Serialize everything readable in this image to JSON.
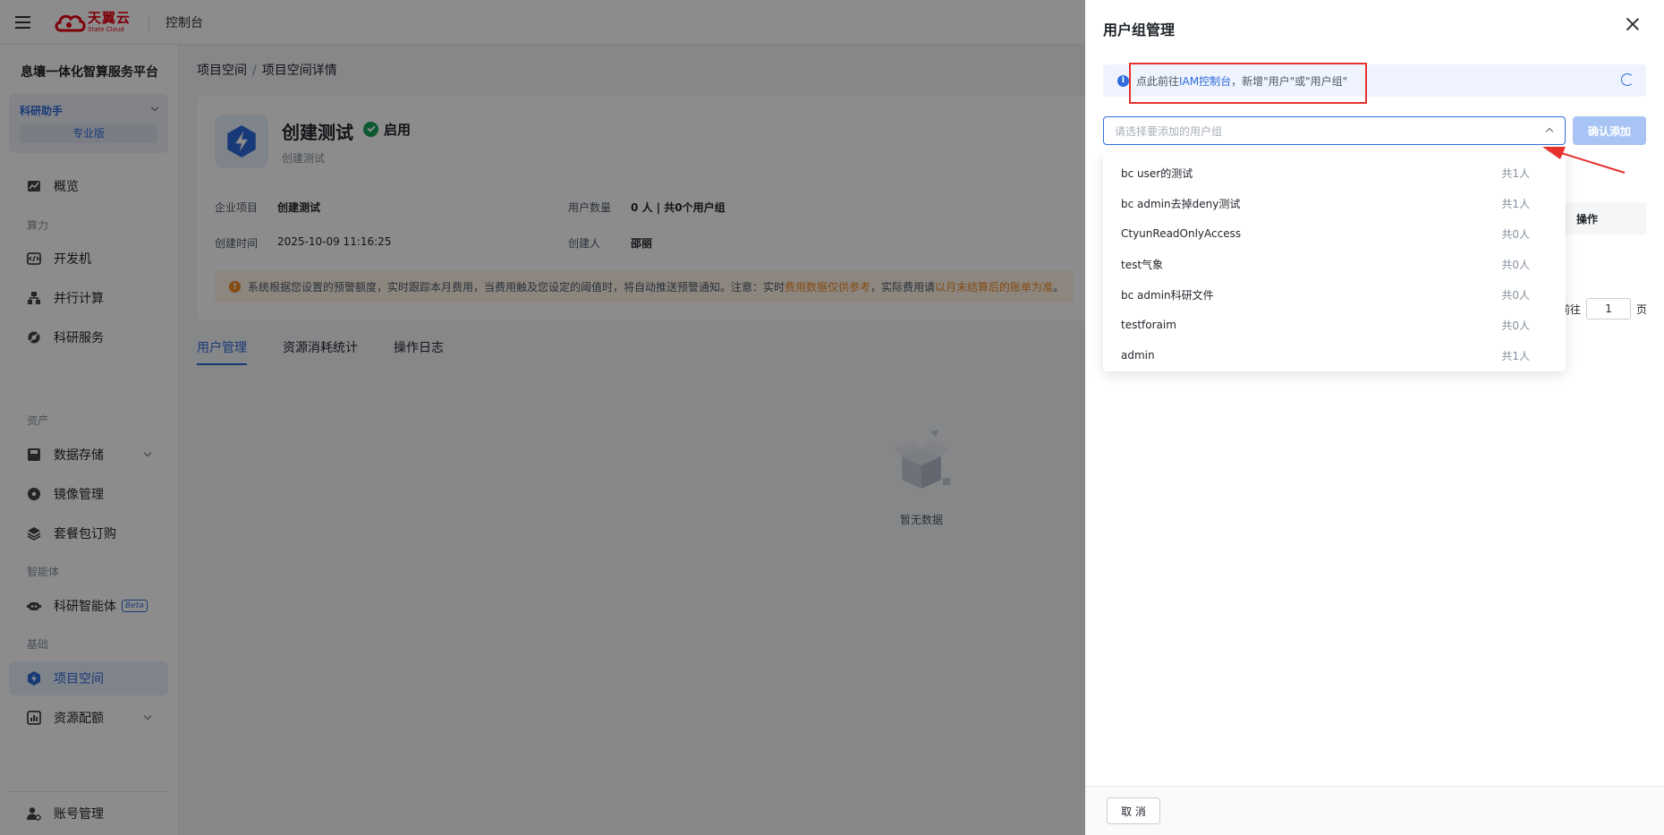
{
  "topbar": {
    "logo_cn": "天翼云",
    "logo_en": "State Cloud",
    "console": "控制台"
  },
  "sidebar": {
    "platform": "息壤一体化智算服务平台",
    "assistant": "科研助手",
    "edition": "专业版",
    "sections": {
      "compute": "算力",
      "assets": "资产",
      "agent": "智能体",
      "basic": "基础"
    },
    "items": [
      {
        "label": "概览",
        "icon": "chart-icon"
      },
      {
        "label": "开发机",
        "icon": "code-icon"
      },
      {
        "label": "并行计算",
        "icon": "cluster-icon"
      },
      {
        "label": "科研服务",
        "icon": "service-icon"
      },
      {
        "label": "数据存储",
        "icon": "storage-icon"
      },
      {
        "label": "镜像管理",
        "icon": "disc-icon"
      },
      {
        "label": "套餐包订购",
        "icon": "layers-icon"
      },
      {
        "label": "科研智能体",
        "icon": "robot-icon"
      },
      {
        "label": "项目空间",
        "icon": "bolt-icon"
      },
      {
        "label": "资源配额",
        "icon": "quota-icon"
      },
      {
        "label": "账号管理",
        "icon": "user-gear-icon"
      }
    ],
    "beta": "Beta"
  },
  "breadcrumb": {
    "root": "项目空间",
    "sep": "/",
    "current": "项目空间详情"
  },
  "project": {
    "name": "创建测试",
    "status": "启用",
    "desc": "创建测试",
    "labels": {
      "enterprise": "企业项目",
      "created": "创建时间",
      "users": "用户数量",
      "creator": "创建人"
    },
    "values": {
      "enterprise": "创建测试",
      "created": "2025-10-09 11:16:25",
      "users": "0 人 | 共0个用户组",
      "creator": "邵丽"
    },
    "warning": {
      "part1": "系统根据您设置的预警额度，实时跟踪本月费用，当费用触及您设定的阈值时，将自动推送预警通知。注意：实时",
      "hl1": "费用数据仅供参考",
      "part2": "，实际费用请",
      "hl2": "以月末结算后的账单为准",
      "end": "。"
    }
  },
  "tabs": [
    "用户管理",
    "资源消耗统计",
    "操作日志"
  ],
  "empty": "暂无数据",
  "drawer": {
    "title": "用户组管理",
    "tip_prefix": "点此前往 ",
    "tip_link": "IAM控制台",
    "tip_suffix": "，新增\"用户\"或\"用户组\"",
    "select_placeholder": "请选择要添加的用户组",
    "confirm": "确认添加",
    "col_op": "操作",
    "pager_goto": "前往",
    "pager_page": "1",
    "pager_unit": "页",
    "cancel": "取 消",
    "options": [
      {
        "name": "bc user的测试",
        "count": "共1人"
      },
      {
        "name": "bc admin去掉deny测试",
        "count": "共1人"
      },
      {
        "name": "CtyunReadOnlyAccess",
        "count": "共0人"
      },
      {
        "name": "test气象",
        "count": "共0人"
      },
      {
        "name": "bc admin科研文件",
        "count": "共0人"
      },
      {
        "name": "testforaim",
        "count": "共0人"
      },
      {
        "name": "admin",
        "count": "共1人"
      }
    ]
  },
  "colors": {
    "primary": "#2f6bdc",
    "brand": "#e60012",
    "warning": "#f08a24",
    "success": "#19a05a",
    "annotation": "#e8312f"
  }
}
